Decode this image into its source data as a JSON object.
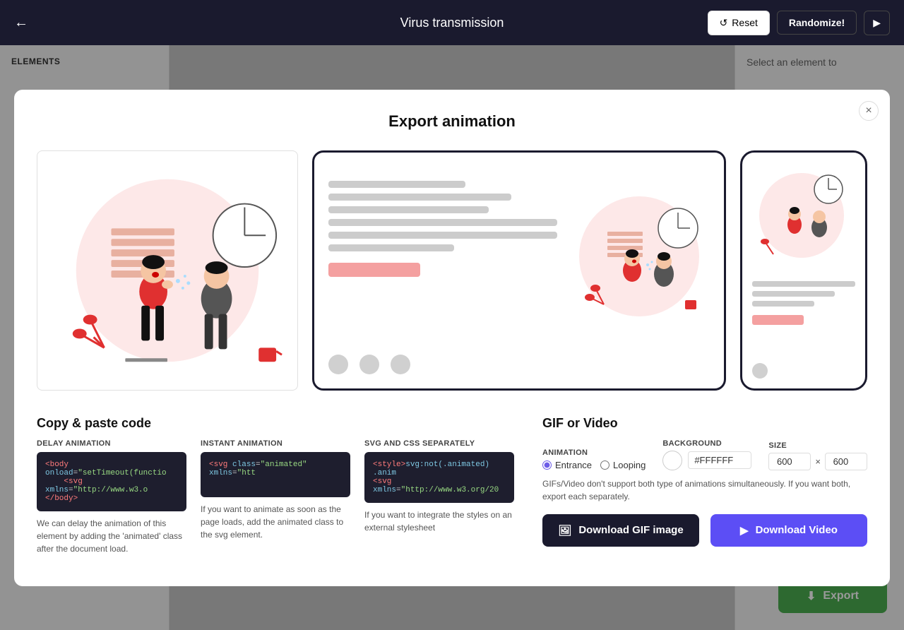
{
  "topbar": {
    "title": "Virus transmission",
    "back_label": "←",
    "reset_label": "Reset",
    "randomize_label": "Randomize!",
    "play_label": "▶"
  },
  "sidebar": {
    "title": "ELEMENTS"
  },
  "right_panel": {
    "text": "Select an element to"
  },
  "modal": {
    "title": "Export animation",
    "close_label": "×",
    "copy_paste": {
      "section_title": "Copy & paste code",
      "delay_label": "DELAY ANIMATION",
      "delay_code_line1": "<body onload=\"setTimeout(functio",
      "delay_code_line2": "    <svg xmlns=\"http://www.w3.o",
      "delay_code_line3": "</body>",
      "delay_desc": "We can delay the animation of this element by adding the 'animated' class after the document load.",
      "instant_label": "INSTANT ANIMATION",
      "instant_code_line1": "<svg class=\"animated\" xmlns=\"htt",
      "instant_desc": "If you want to animate as soon as the page loads, add the animated class to the svg element.",
      "svg_css_label": "SVG AND CSS SEPARATELY",
      "svg_css_code_line1": "<style>svg:not(.animated) .anim",
      "svg_css_code_line2": "<svg xmlns=\"http://www.w3.org/20",
      "svg_css_desc": "If you want to integrate the styles on an external stylesheet"
    },
    "gif_video": {
      "section_title": "GIF or Video",
      "animation_label": "ANIMATION",
      "entrance_label": "Entrance",
      "looping_label": "Looping",
      "background_label": "BACKGROUND",
      "bg_color": "#FFFFFF",
      "size_label": "SIZE",
      "size_width": "600",
      "size_height": "600",
      "notice": "GIFs/Video don't support both type of animations simultaneously. If you want both, export each separately.",
      "download_gif_label": "Download GIF image",
      "download_video_label": "Download Video"
    }
  },
  "export_btn": {
    "label": "Export",
    "icon": "⬇"
  }
}
